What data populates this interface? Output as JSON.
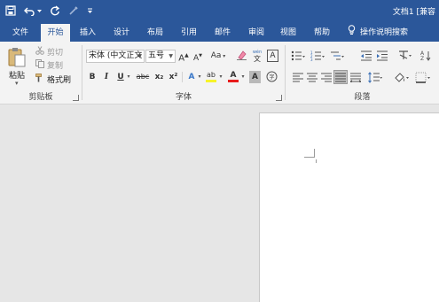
{
  "window": {
    "title": "文档1 [兼容"
  },
  "quick_access": [
    "save-icon",
    "undo-icon",
    "redo-icon",
    "format-painter-icon",
    "customize-icon"
  ],
  "tabs": [
    {
      "label": "文件"
    },
    {
      "label": "开始",
      "active": true
    },
    {
      "label": "插入"
    },
    {
      "label": "设计"
    },
    {
      "label": "布局"
    },
    {
      "label": "引用"
    },
    {
      "label": "邮件"
    },
    {
      "label": "审阅"
    },
    {
      "label": "视图"
    },
    {
      "label": "帮助"
    }
  ],
  "tell_me": {
    "label": "操作说明搜索",
    "icon": "lightbulb-icon"
  },
  "clipboard": {
    "group_label": "剪贴板",
    "paste_label": "粘贴",
    "cut_label": "剪切",
    "copy_label": "复制",
    "format_painter_label": "格式刷"
  },
  "font": {
    "group_label": "字体",
    "font_name": "宋体 (中文正文",
    "font_size": "五号",
    "grow": "A",
    "shrink": "A",
    "change_case": "Aa",
    "bold": "B",
    "italic": "I",
    "underline": "U",
    "strikethrough": "abc",
    "subscript": "x₂",
    "superscript": "x²",
    "text_effects": "A",
    "highlight": "ab",
    "font_color": "A",
    "char_shading": "A",
    "phonetic": "文",
    "char_border": "A"
  },
  "paragraph": {
    "group_label": "段落"
  },
  "colors": {
    "brand": "#2b579a",
    "ribbon_bg": "#f3f3f3",
    "workspace": "#e6e6e6",
    "font_color_bar": "#e81c1c",
    "highlight_bar": "#f7f32a"
  }
}
